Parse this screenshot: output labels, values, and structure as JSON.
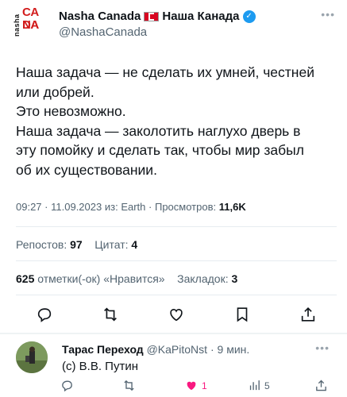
{
  "tweet": {
    "account": {
      "display_name": "Nasha Canada",
      "display_name_cyr": "Наша Канада",
      "handle": "@NashaCanada",
      "logo_side": "nasha",
      "logo_top": "CA NA",
      "logo_bottom": "DA",
      "verified_icon": "verified-badge-icon",
      "flag_icon": "canada-flag-icon"
    },
    "text_lines": [
      "Наша задача — не сделать их умней, честней",
      "или добрей.",
      "Это невозможно.",
      "Наша задача — заколотить наглухо дверь в",
      "эту помойку и сделать так, чтобы мир забыл",
      "об их существовании."
    ],
    "time": "09:27",
    "date": "11.09.2023",
    "source_prefix": "из:",
    "source": "Earth",
    "views_label": "Просмотров:",
    "views_value": "11,6K",
    "reposts_label": "Репостов:",
    "reposts_value": "97",
    "quotes_label": "Цитат:",
    "quotes_value": "4",
    "likes_value": "625",
    "likes_label": "отметки(-ок) «Нравится»",
    "bookmarks_label": "Закладок:",
    "bookmarks_value": "3",
    "actions": [
      "reply-icon",
      "retweet-icon",
      "like-icon",
      "bookmark-icon",
      "share-icon"
    ]
  },
  "reply": {
    "display_name": "Тарас Переход",
    "handle": "@KaPitoNst",
    "separator": "·",
    "time_ago": "9 мин.",
    "text": "(с) В.В. Путин",
    "likes": "1",
    "views": "5",
    "like_color": "#f91880"
  },
  "colors": {
    "accent": "#1d9bf0",
    "secondary_text": "#536471",
    "logo_red": "#d21c1c"
  }
}
